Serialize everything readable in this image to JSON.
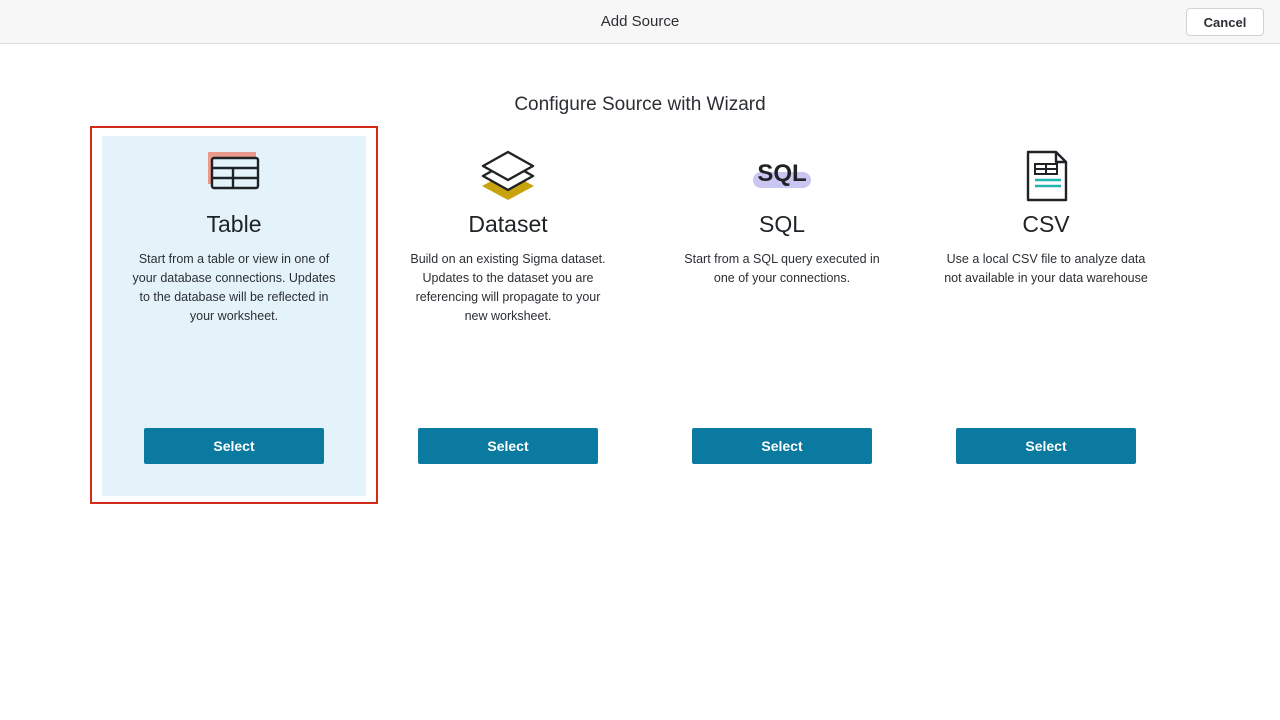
{
  "header": {
    "title": "Add Source",
    "cancel_label": "Cancel"
  },
  "main": {
    "heading": "Configure Source with Wizard",
    "cards": [
      {
        "title": "Table",
        "description": "Start from a table or view in one of your database connections. Updates to the database will be reflected in your worksheet.",
        "button_label": "Select",
        "icon": "table-icon",
        "selected": true
      },
      {
        "title": "Dataset",
        "description": "Build on an existing Sigma dataset. Updates to the dataset you are referencing will propagate to your new worksheet.",
        "button_label": "Select",
        "icon": "layers-icon",
        "selected": false
      },
      {
        "title": "SQL",
        "description": "Start from a SQL query executed in one of your connections.",
        "button_label": "Select",
        "icon": "sql-icon",
        "icon_text": "SQL",
        "selected": false
      },
      {
        "title": "CSV",
        "description": "Use a local CSV file to analyze data not available in your data warehouse",
        "button_label": "Select",
        "icon": "csv-file-icon",
        "selected": false
      }
    ]
  },
  "colors": {
    "accent_button": "#0a7aa0",
    "selected_card_bg": "#e4f3fa",
    "highlight_border": "#d42a1a"
  }
}
